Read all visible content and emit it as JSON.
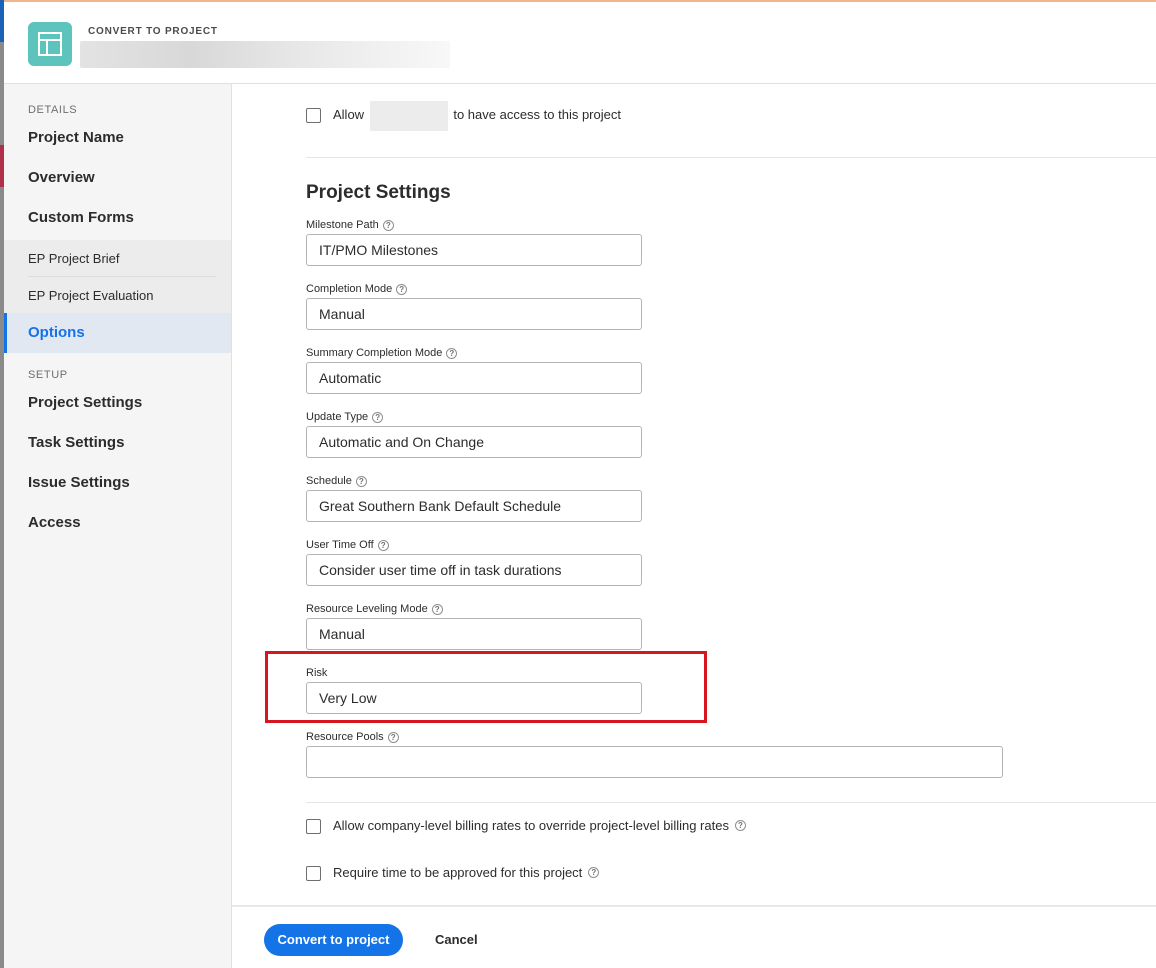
{
  "header": {
    "kicker": "CONVERT TO PROJECT"
  },
  "sidebar": {
    "details_label": "DETAILS",
    "setup_label": "SETUP",
    "items": [
      {
        "label": "Project Name"
      },
      {
        "label": "Overview"
      },
      {
        "label": "Custom Forms"
      },
      {
        "label": "EP Project Brief"
      },
      {
        "label": "EP Project Evaluation"
      },
      {
        "label": "Options"
      },
      {
        "label": "Project Settings"
      },
      {
        "label": "Task Settings"
      },
      {
        "label": "Issue Settings"
      },
      {
        "label": "Access"
      }
    ],
    "active_item": "Options"
  },
  "main": {
    "allow_prefix": "Allow",
    "allow_suffix": "to have access to this project",
    "section_title": "Project Settings",
    "fields": [
      {
        "label": "Milestone Path",
        "value": "IT/PMO Milestones"
      },
      {
        "label": "Completion Mode",
        "value": "Manual"
      },
      {
        "label": "Summary Completion Mode",
        "value": "Automatic"
      },
      {
        "label": "Update Type",
        "value": "Automatic and On Change"
      },
      {
        "label": "Schedule",
        "value": "Great Southern Bank Default Schedule"
      },
      {
        "label": "User Time Off",
        "value": "Consider user time off in task durations"
      },
      {
        "label": "Resource Leveling Mode",
        "value": "Manual"
      },
      {
        "label": "Risk",
        "value": "Very Low"
      },
      {
        "label": "Resource Pools",
        "value": ""
      }
    ],
    "billing_checkbox_label": "Allow company-level billing rates to override project-level billing rates",
    "time_checkbox_label": "Require time to be approved for this project"
  },
  "footer": {
    "primary_label": "Convert to project",
    "cancel_label": "Cancel"
  },
  "colors": {
    "accent": "#1473e6",
    "icon_bg": "#5cc3bd",
    "highlight": "#d7161f"
  }
}
